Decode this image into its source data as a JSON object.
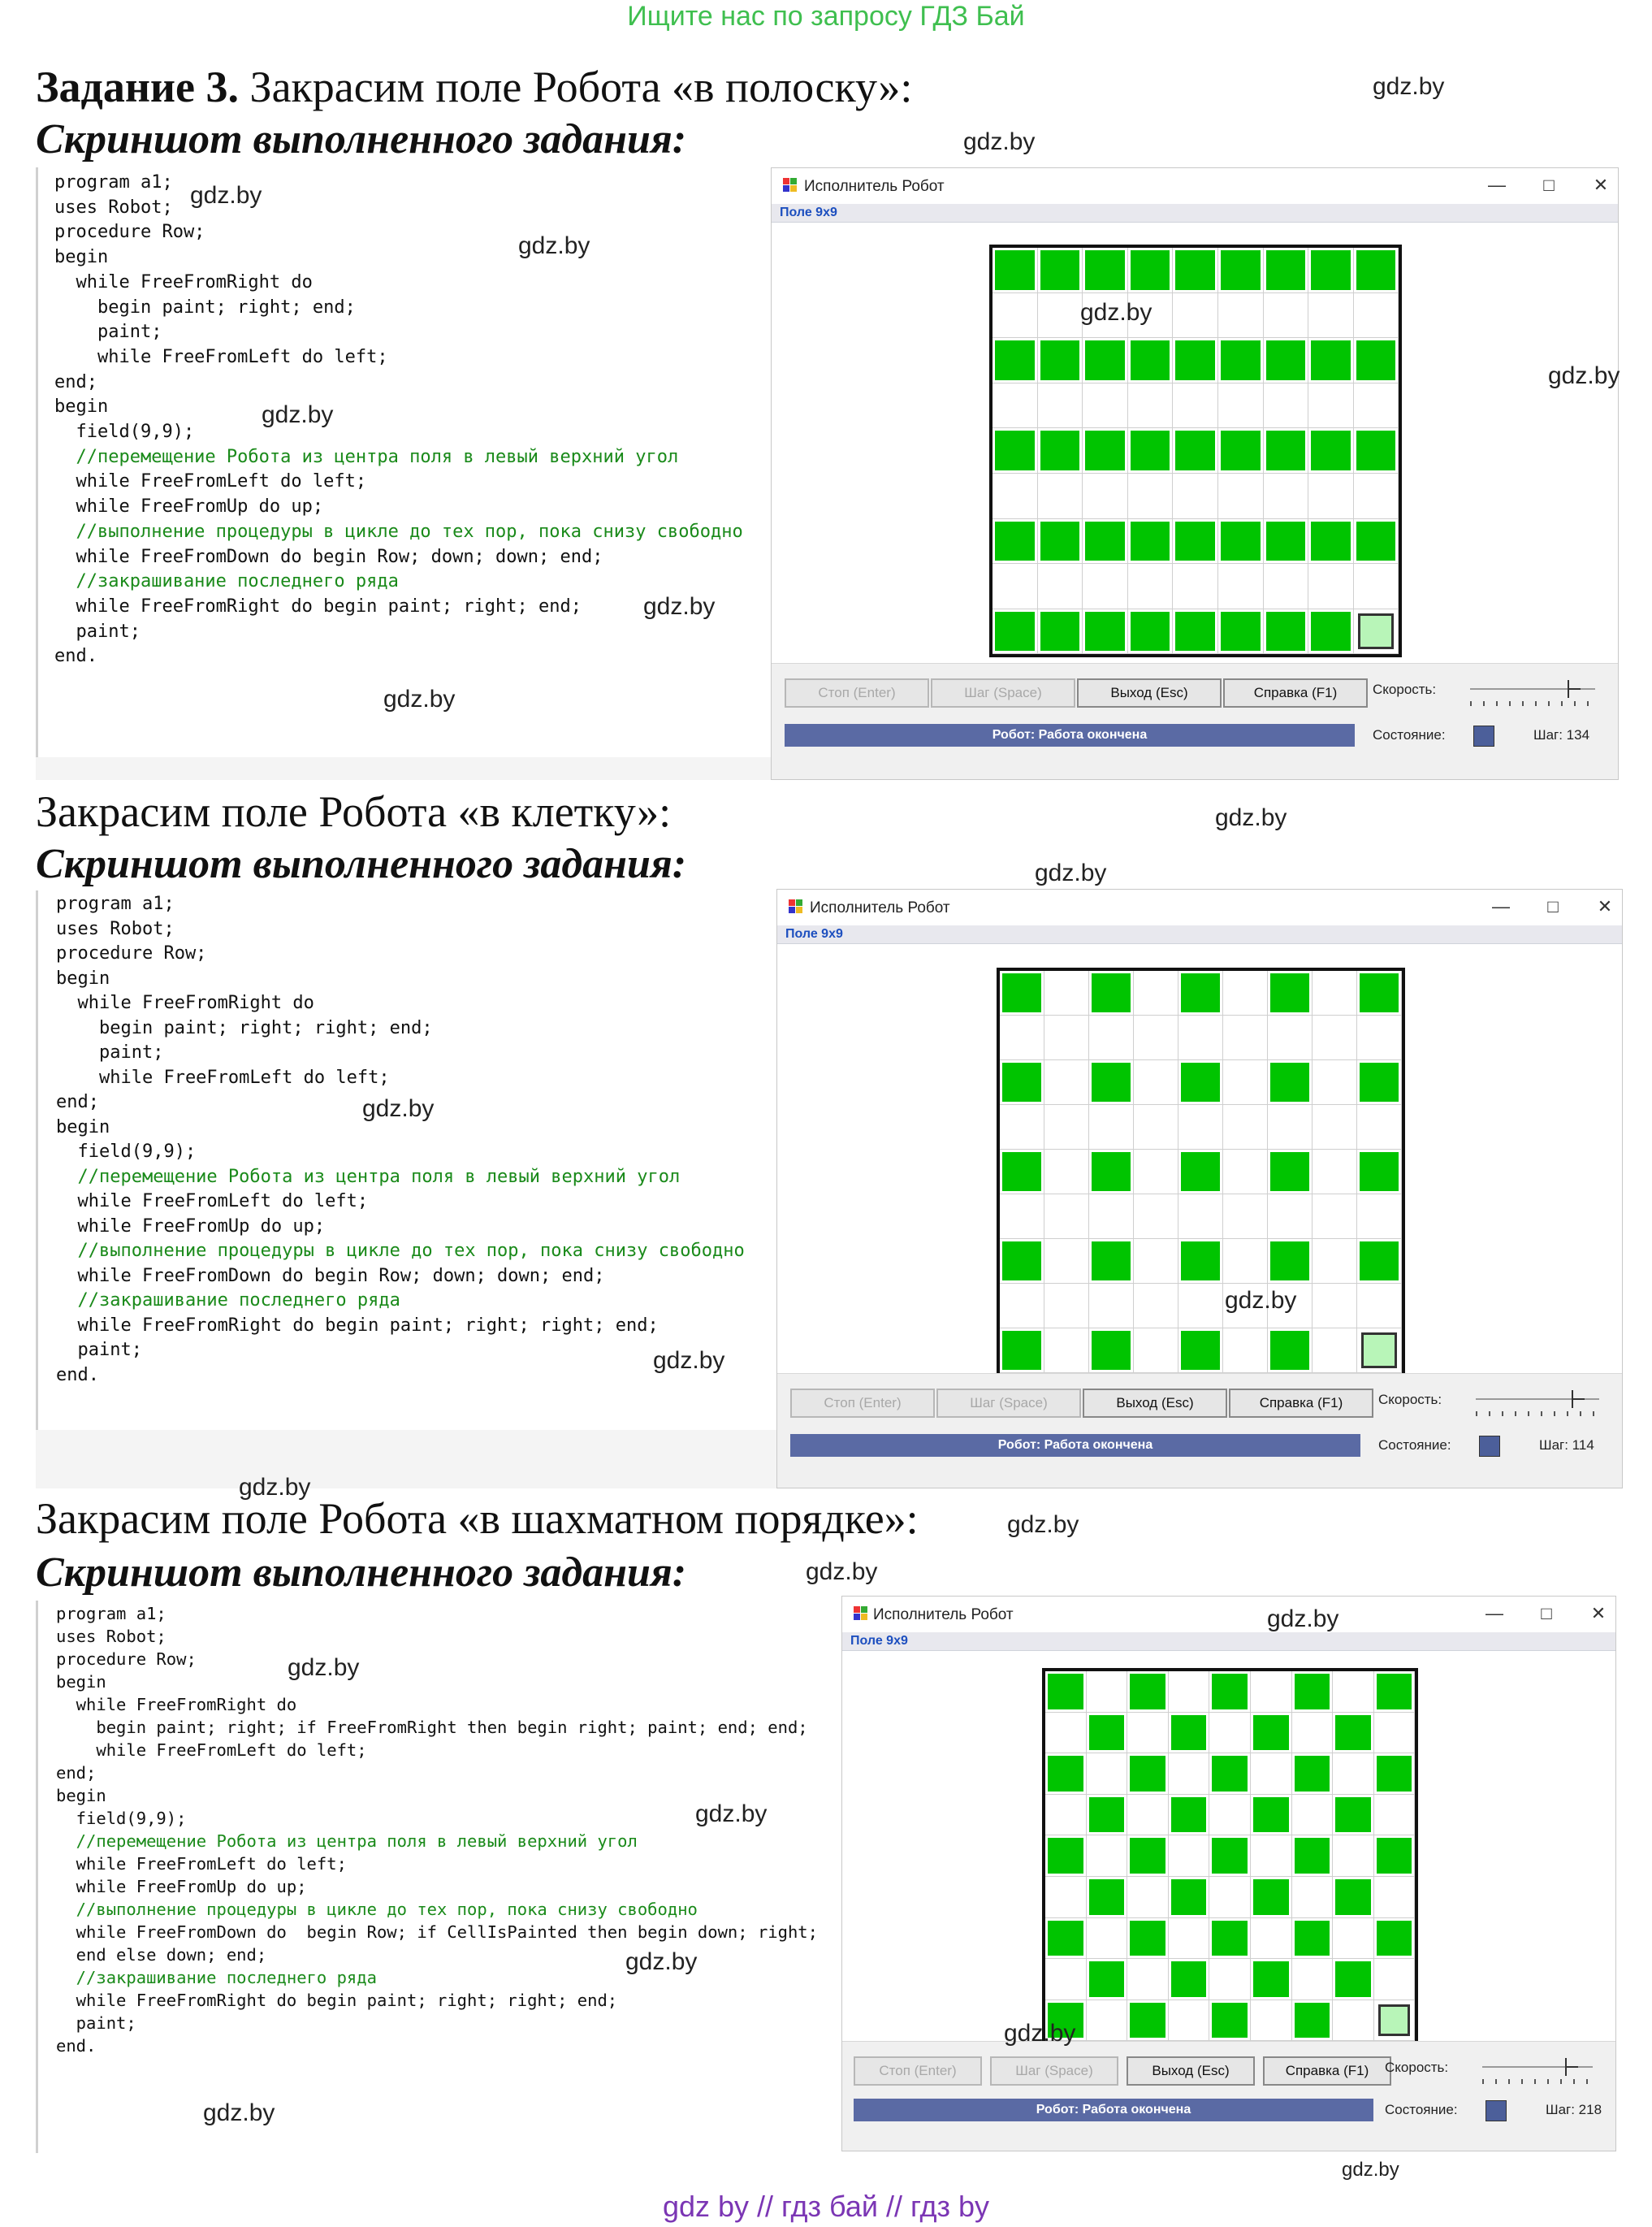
{
  "banner": "Ищите нас по запросу ГДЗ Бай",
  "footer": "gdz by  //  гдз бай  //  гдз by",
  "watermark": "gdz.by",
  "window": {
    "title": "Исполнитель Робот",
    "menu": "Поле 9x9",
    "buttons": {
      "stop": "Стоп (Enter)",
      "step": "Шаг (Space)",
      "exit": "Выход (Esc)",
      "help": "Справка (F1)"
    },
    "status": "Робот: Работа окончена",
    "speed_label": "Скорость:",
    "state_label": "Состояние:",
    "min_icon": "minimize-icon",
    "max_icon": "maximize-icon",
    "close_icon": "close-icon"
  },
  "task1": {
    "heading_bold": "Задание 3.",
    "heading_rest": " Закрасим поле Робота «в полоску»:",
    "subheading": "Скриншот выполненного задания:",
    "code": [
      {
        "t": "program a1;",
        "c": false
      },
      {
        "t": "uses Robot;",
        "c": false
      },
      {
        "t": "procedure Row;",
        "c": false
      },
      {
        "t": "begin",
        "c": false
      },
      {
        "t": "  while FreeFromRight do",
        "c": false
      },
      {
        "t": "    begin paint; right; end;",
        "c": false
      },
      {
        "t": "    paint;",
        "c": false
      },
      {
        "t": "    while FreeFromLeft do left;",
        "c": false
      },
      {
        "t": "end;",
        "c": false
      },
      {
        "t": "begin",
        "c": false
      },
      {
        "t": "  field(9,9);",
        "c": false
      },
      {
        "t": "  //перемещение Робота из центра поля в левый верхний угол",
        "c": true
      },
      {
        "t": "  while FreeFromLeft do left;",
        "c": false
      },
      {
        "t": "  while FreeFromUp do up;",
        "c": false
      },
      {
        "t": "  //выполнение процедуры в цикле до тех пор, пока снизу свободно",
        "c": true
      },
      {
        "t": "  while FreeFromDown do begin Row; down; down; end;",
        "c": false
      },
      {
        "t": "  //закрашивание последнего ряда",
        "c": true
      },
      {
        "t": "  while FreeFromRight do begin paint; right; end;",
        "c": false
      },
      {
        "t": "  paint;",
        "c": false
      },
      {
        "t": "end.",
        "c": false
      }
    ],
    "steps": "Шаг: 134",
    "grid_pattern": "stripes",
    "grid_size": 9
  },
  "task2": {
    "heading": "Закрасим поле Робота «в клетку»:",
    "subheading": "Скриншот выполненного задания:",
    "code": [
      {
        "t": "program a1;",
        "c": false
      },
      {
        "t": "uses Robot;",
        "c": false
      },
      {
        "t": "procedure Row;",
        "c": false
      },
      {
        "t": "begin",
        "c": false
      },
      {
        "t": "  while FreeFromRight do",
        "c": false
      },
      {
        "t": "    begin paint; right; right; end;",
        "c": false
      },
      {
        "t": "    paint;",
        "c": false
      },
      {
        "t": "    while FreeFromLeft do left;",
        "c": false
      },
      {
        "t": "end;",
        "c": false
      },
      {
        "t": "begin",
        "c": false
      },
      {
        "t": "  field(9,9);",
        "c": false
      },
      {
        "t": "  //перемещение Робота из центра поля в левый верхний угол",
        "c": true
      },
      {
        "t": "  while FreeFromLeft do left;",
        "c": false
      },
      {
        "t": "  while FreeFromUp do up;",
        "c": false
      },
      {
        "t": "  //выполнение процедуры в цикле до тех пор, пока снизу свободно",
        "c": true
      },
      {
        "t": "  while FreeFromDown do begin Row; down; down; end;",
        "c": false
      },
      {
        "t": "  //закрашивание последнего ряда",
        "c": true
      },
      {
        "t": "  while FreeFromRight do begin paint; right; right; end;",
        "c": false
      },
      {
        "t": "  paint;",
        "c": false
      },
      {
        "t": "end.",
        "c": false
      }
    ],
    "steps": "Шаг: 114",
    "grid_pattern": "cells",
    "grid_size": 9
  },
  "task3": {
    "heading": "Закрасим поле Робота «в шахматном порядке»:",
    "subheading": "Скриншот выполненного задания:",
    "code": [
      {
        "t": "program a1;",
        "c": false
      },
      {
        "t": "uses Robot;",
        "c": false
      },
      {
        "t": "procedure Row;",
        "c": false
      },
      {
        "t": "begin",
        "c": false
      },
      {
        "t": "  while FreeFromRight do",
        "c": false
      },
      {
        "t": "    begin paint; right; if FreeFromRight then begin right; paint; end; end;",
        "c": false
      },
      {
        "t": "    while FreeFromLeft do left;",
        "c": false
      },
      {
        "t": "end;",
        "c": false
      },
      {
        "t": "begin",
        "c": false
      },
      {
        "t": "  field(9,9);",
        "c": false
      },
      {
        "t": "  //перемещение Робота из центра поля в левый верхний угол",
        "c": true
      },
      {
        "t": "  while FreeFromLeft do left;",
        "c": false
      },
      {
        "t": "  while FreeFromUp do up;",
        "c": false
      },
      {
        "t": "  //выполнение процедуры в цикле до тех пор, пока снизу свободно",
        "c": true
      },
      {
        "t": "  while FreeFromDown do  begin Row; if CellIsPainted then begin down; right;",
        "c": false
      },
      {
        "t": "  end else down; end;",
        "c": false
      },
      {
        "t": "  //закрашивание последнего ряда",
        "c": true
      },
      {
        "t": "  while FreeFromRight do begin paint; right; right; end;",
        "c": false
      },
      {
        "t": "  paint;",
        "c": false
      },
      {
        "t": "end.",
        "c": false
      }
    ],
    "steps": "Шаг: 218",
    "grid_pattern": "checker",
    "grid_size": 9
  }
}
